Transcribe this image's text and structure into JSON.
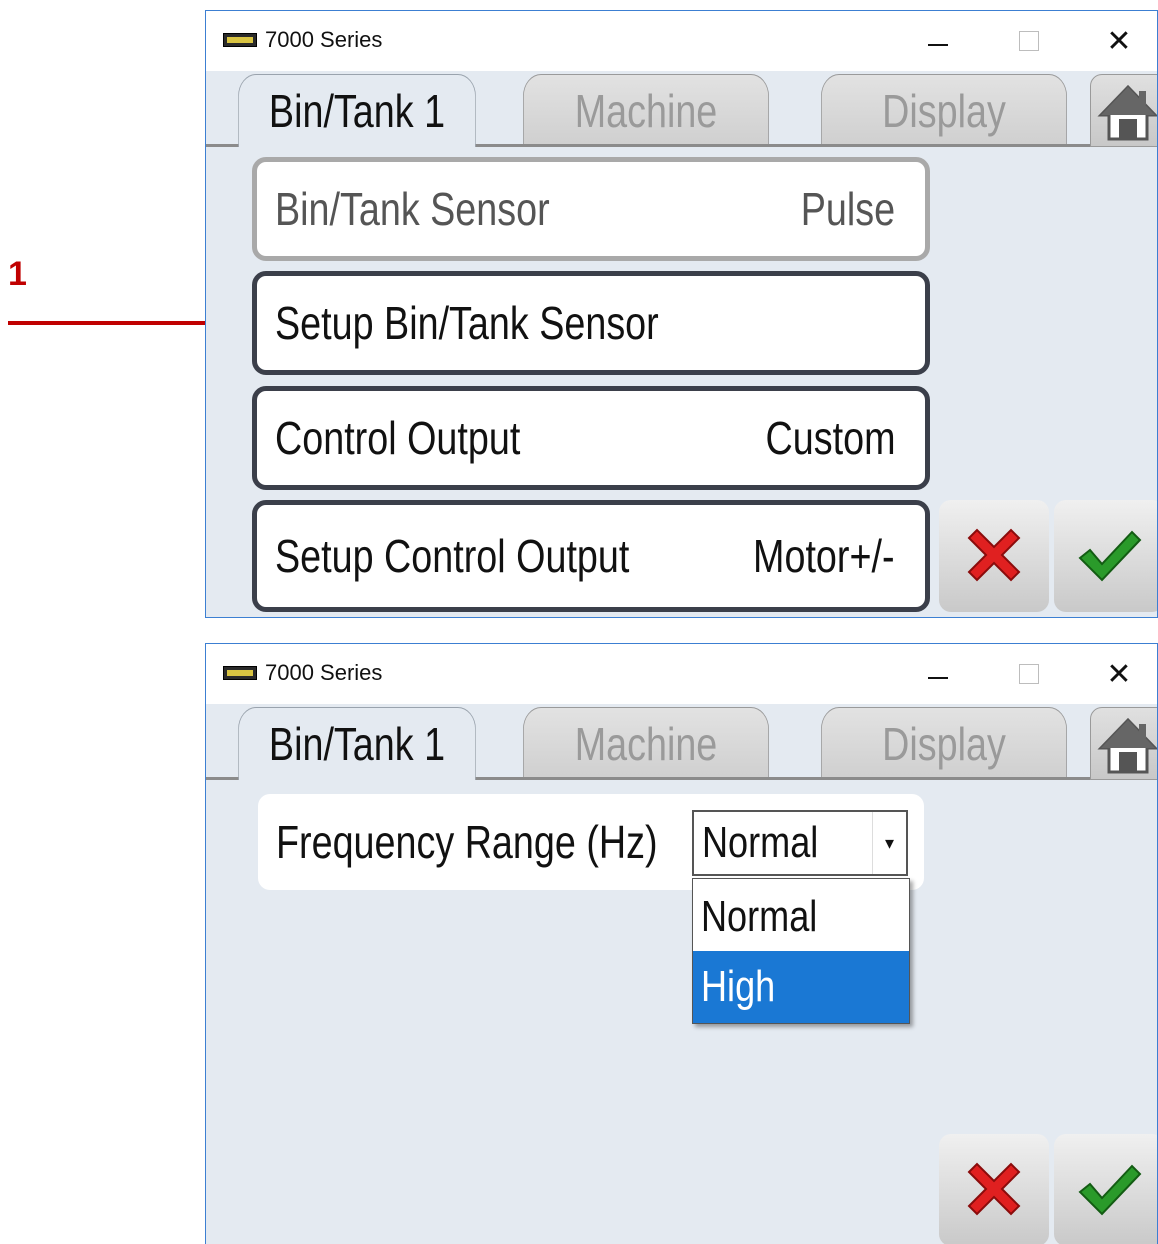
{
  "annotation": {
    "number": "1",
    "color": "#c00000"
  },
  "windows": [
    {
      "title": "7000 Series",
      "tabs": [
        {
          "label": "Bin/Tank 1",
          "active": true
        },
        {
          "label": "Machine",
          "active": false
        },
        {
          "label": "Display",
          "active": false
        }
      ],
      "menu": [
        {
          "label": "Bin/Tank Sensor",
          "value": "Pulse"
        },
        {
          "label": "Setup Bin/Tank Sensor",
          "value": ""
        },
        {
          "label": "Control Output",
          "value": "Custom"
        },
        {
          "label": "Setup Control Output",
          "value": "Motor+/-"
        }
      ]
    },
    {
      "title": "7000 Series",
      "tabs": [
        {
          "label": "Bin/Tank 1",
          "active": true
        },
        {
          "label": "Machine",
          "active": false
        },
        {
          "label": "Display",
          "active": false
        }
      ],
      "frequency": {
        "label": "Frequency Range (Hz)",
        "selected": "Normal",
        "options": [
          "Normal",
          "High"
        ],
        "highlighted": "High"
      }
    }
  ],
  "icons": {
    "home": "home-icon",
    "cancel": "red-x-icon",
    "confirm": "green-check-icon"
  },
  "colors": {
    "accent_red": "#c00000",
    "selection_blue": "#1a78d4",
    "window_bg": "#e4eaf1",
    "cancel_red": "#e02020",
    "confirm_green": "#2a9a2a"
  }
}
